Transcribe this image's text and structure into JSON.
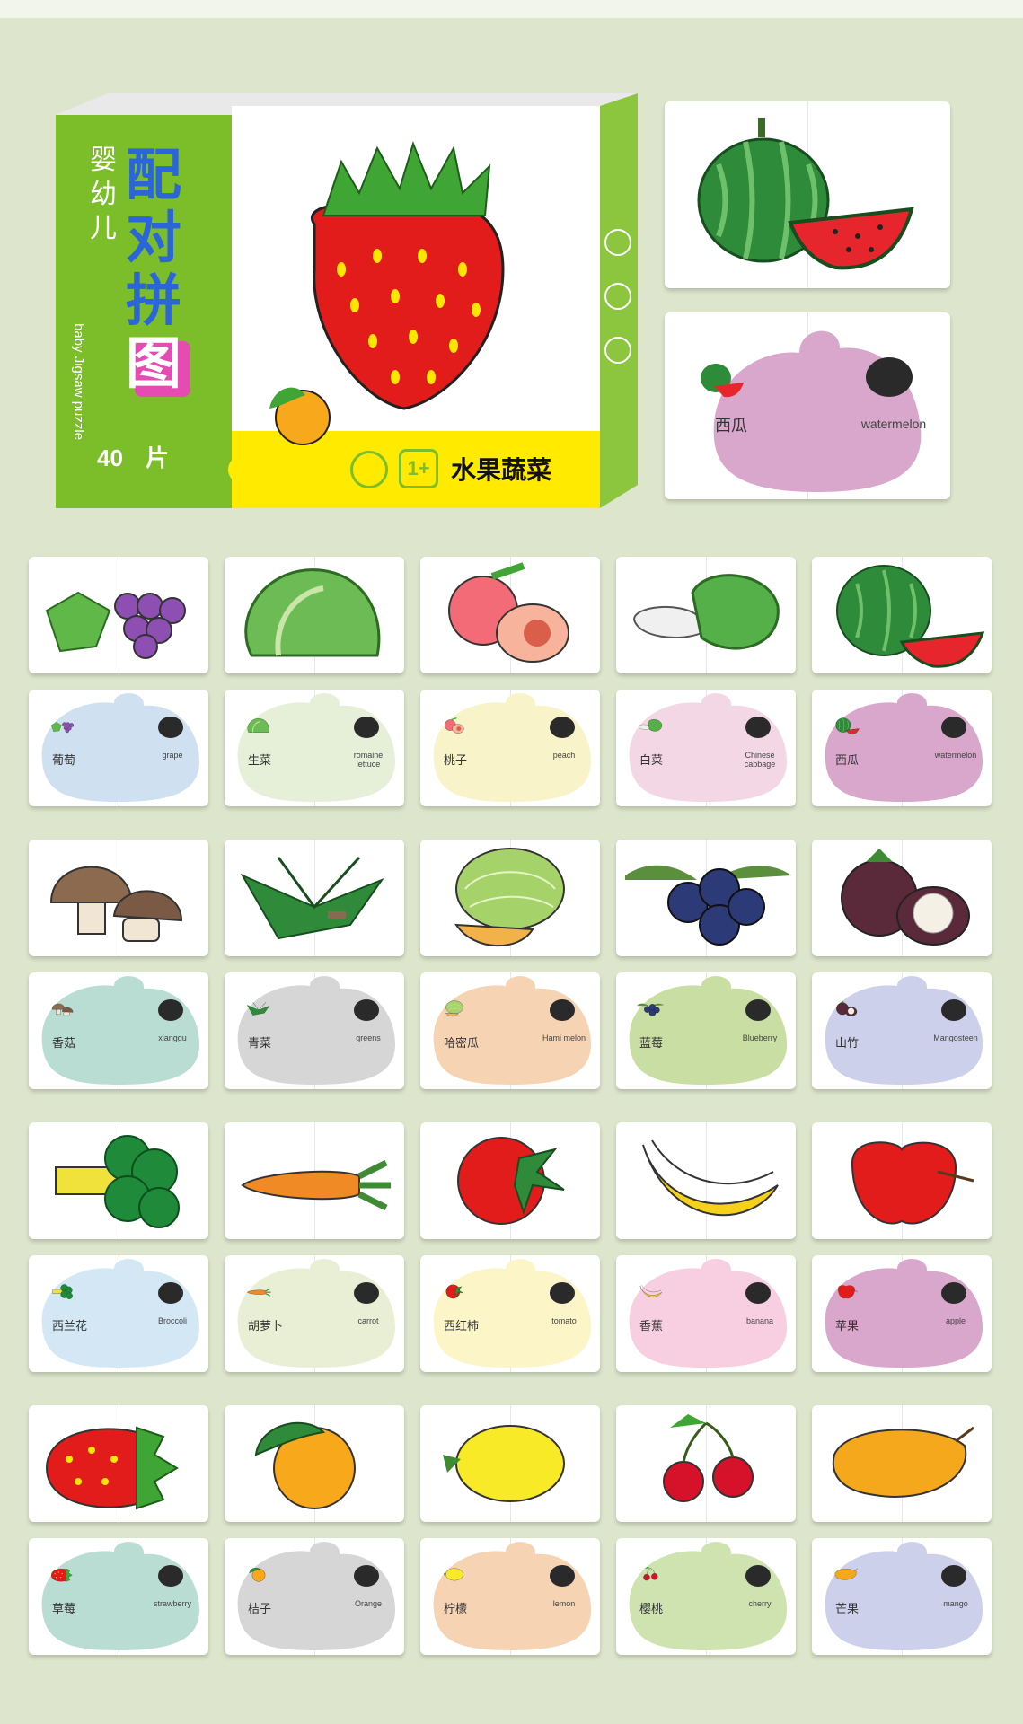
{
  "box": {
    "title_small": "婴幼儿",
    "title_big": [
      "配",
      "对",
      "拼",
      "图"
    ],
    "title_en": "baby Jigsaw puzzle",
    "pieces": "40",
    "pieces_unit": "片",
    "age": "1+",
    "category": "水果蔬菜"
  },
  "colors": {
    "background": "#dde6cc",
    "box_green": "#7cbd2a",
    "box_yellow": "#ffea00",
    "title_blue": "#2b66d8"
  },
  "feature_card": {
    "cn": "西瓜",
    "en": "watermelon",
    "shape_color": "#d9a6cc"
  },
  "rows": [
    [
      {
        "cn": "葡萄",
        "en": "grape",
        "shape_color": "#cfe0f0",
        "fruit": "grape"
      },
      {
        "cn": "生菜",
        "en": "romaine lettuce",
        "shape_color": "#e6efd8",
        "fruit": "lettuce"
      },
      {
        "cn": "桃子",
        "en": "peach",
        "shape_color": "#f8f3c8",
        "fruit": "peach"
      },
      {
        "cn": "白菜",
        "en": "Chinese cabbage",
        "shape_color": "#f4d7e4",
        "fruit": "cabbage"
      },
      {
        "cn": "西瓜",
        "en": "watermelon",
        "shape_color": "#d9a6cc",
        "fruit": "watermelon"
      }
    ],
    [
      {
        "cn": "香菇",
        "en": "xianggu",
        "shape_color": "#b9ddd3",
        "fruit": "mushroom"
      },
      {
        "cn": "青菜",
        "en": "greens",
        "shape_color": "#d6d6d6",
        "fruit": "greens"
      },
      {
        "cn": "哈密瓜",
        "en": "Hami melon",
        "shape_color": "#f6d3b3",
        "fruit": "melon"
      },
      {
        "cn": "蓝莓",
        "en": "Blueberry",
        "shape_color": "#c8dea3",
        "fruit": "blueberry"
      },
      {
        "cn": "山竹",
        "en": "Mangosteen",
        "shape_color": "#ccd0ea",
        "fruit": "mangosteen"
      }
    ],
    [
      {
        "cn": "西兰花",
        "en": "Broccoli",
        "shape_color": "#d3e7f5",
        "fruit": "broccoli"
      },
      {
        "cn": "胡萝卜",
        "en": "carrot",
        "shape_color": "#e8efd5",
        "fruit": "carrot"
      },
      {
        "cn": "西红柿",
        "en": "tomato",
        "shape_color": "#fbf5c8",
        "fruit": "tomato"
      },
      {
        "cn": "香蕉",
        "en": "banana",
        "shape_color": "#f8cfe0",
        "fruit": "banana"
      },
      {
        "cn": "苹果",
        "en": "apple",
        "shape_color": "#d9a6cc",
        "fruit": "apple"
      }
    ],
    [
      {
        "cn": "草莓",
        "en": "strawberry",
        "shape_color": "#b9ddd3",
        "fruit": "strawberry"
      },
      {
        "cn": "桔子",
        "en": "Orange",
        "shape_color": "#d6d6d6",
        "fruit": "orange"
      },
      {
        "cn": "柠檬",
        "en": "lemon",
        "shape_color": "#f6d3b3",
        "fruit": "lemon"
      },
      {
        "cn": "樱桃",
        "en": "cherry",
        "shape_color": "#cfe3b0",
        "fruit": "cherry"
      },
      {
        "cn": "芒果",
        "en": "mango",
        "shape_color": "#ccd0ea",
        "fruit": "mango"
      }
    ]
  ]
}
